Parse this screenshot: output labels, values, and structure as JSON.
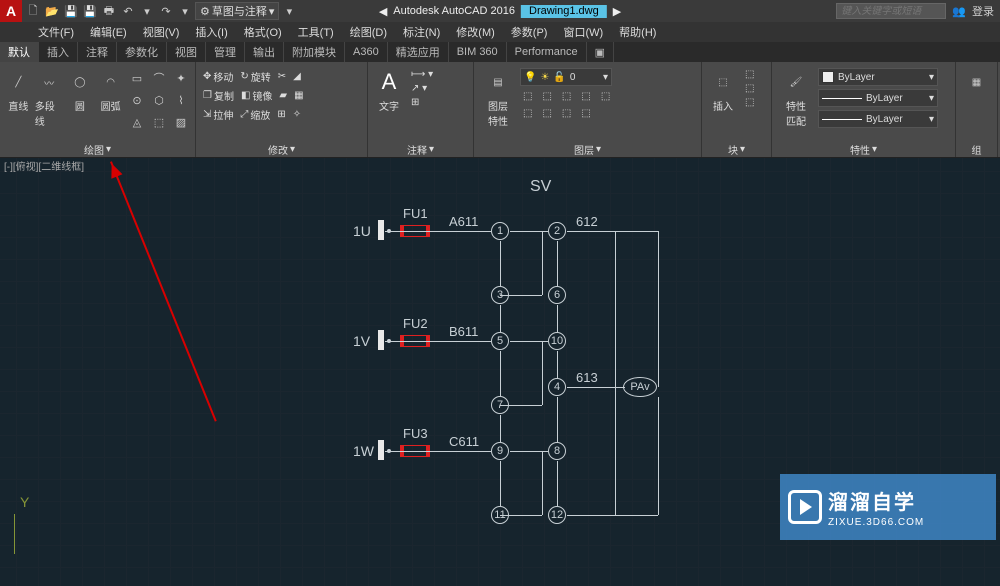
{
  "title": {
    "app": "Autodesk AutoCAD 2016",
    "doc": "Drawing1.dwg"
  },
  "workspace": "草图与注释",
  "search_placeholder": "键入关键字或短语",
  "login_label": "登录",
  "menus": [
    "文件(F)",
    "编辑(E)",
    "视图(V)",
    "插入(I)",
    "格式(O)",
    "工具(T)",
    "绘图(D)",
    "标注(N)",
    "修改(M)",
    "参数(P)",
    "窗口(W)",
    "帮助(H)"
  ],
  "tabs": [
    "默认",
    "插入",
    "注释",
    "参数化",
    "视图",
    "管理",
    "输出",
    "附加模块",
    "A360",
    "精选应用",
    "BIM 360",
    "Performance"
  ],
  "panels": {
    "draw": {
      "title": "绘图",
      "big": [
        "直线",
        "多段线",
        "圆",
        "圆弧"
      ]
    },
    "modify": {
      "title": "修改",
      "items": [
        "移动",
        "旋转",
        "复制",
        "镜像",
        "拉伸",
        "缩放"
      ]
    },
    "annotate": {
      "title": "注释",
      "big": "文字"
    },
    "layers": {
      "title": "图层",
      "big": "图层\n特性",
      "current": "0"
    },
    "block": {
      "title": "块",
      "big": "插入"
    },
    "props": {
      "title": "特性",
      "big": "特性\n匹配",
      "layer": "ByLayer",
      "line1": "ByLayer",
      "line2": "ByLayer"
    },
    "group": {
      "title": "组"
    }
  },
  "viewport_label": "[-][俯视][二维线框]",
  "drawing": {
    "title": "SV",
    "rows": [
      {
        "term": "1U",
        "fuse": "FU1",
        "wire": "A611"
      },
      {
        "term": "1V",
        "fuse": "FU2",
        "wire": "B611"
      },
      {
        "term": "1W",
        "fuse": "FU3",
        "wire": "C611"
      }
    ],
    "nodes_left": [
      "1",
      "3",
      "5",
      "7",
      "9",
      "11"
    ],
    "nodes_right": [
      "2",
      "6",
      "10",
      "4",
      "8",
      "12"
    ],
    "labels_right": {
      "top": "612",
      "mid": "613"
    },
    "meter": "PAv"
  },
  "axis": "Y",
  "watermark": {
    "name": "溜溜自学",
    "sub": "ZIXUE.3D66.COM"
  }
}
